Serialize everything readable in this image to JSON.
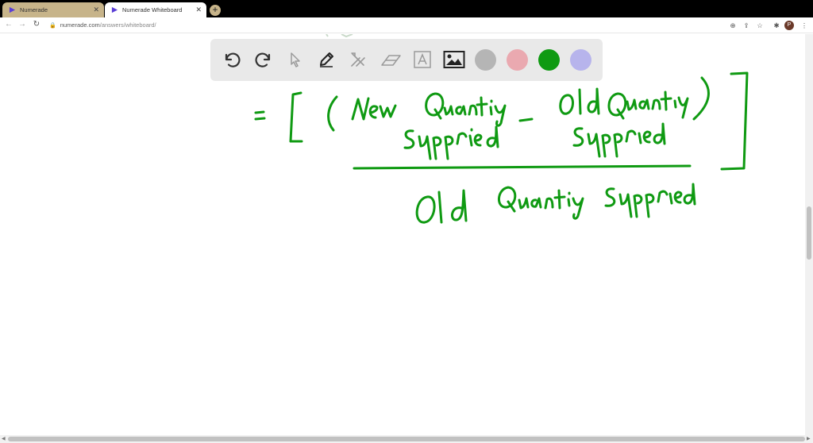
{
  "browser": {
    "tabs": [
      {
        "title": "Numerade",
        "active": false
      },
      {
        "title": "Numerade Whiteboard",
        "active": true
      }
    ],
    "new_tab_label": "+",
    "url": {
      "host": "numerade.com",
      "path": "/answers/whiteboard/"
    },
    "profile_initial": "P"
  },
  "whiteboard": {
    "tools": [
      "undo-icon",
      "redo-icon",
      "select-pointer-icon",
      "pen-icon",
      "tools-icon",
      "eraser-icon",
      "text-icon",
      "image-icon"
    ],
    "colors": {
      "gray": "#b5b5b5",
      "pink": "#eaa9b0",
      "green": "#0f9a12",
      "lavender": "#b7b4ec"
    },
    "selected_color": "green",
    "ink_color": "#0f9a12"
  }
}
